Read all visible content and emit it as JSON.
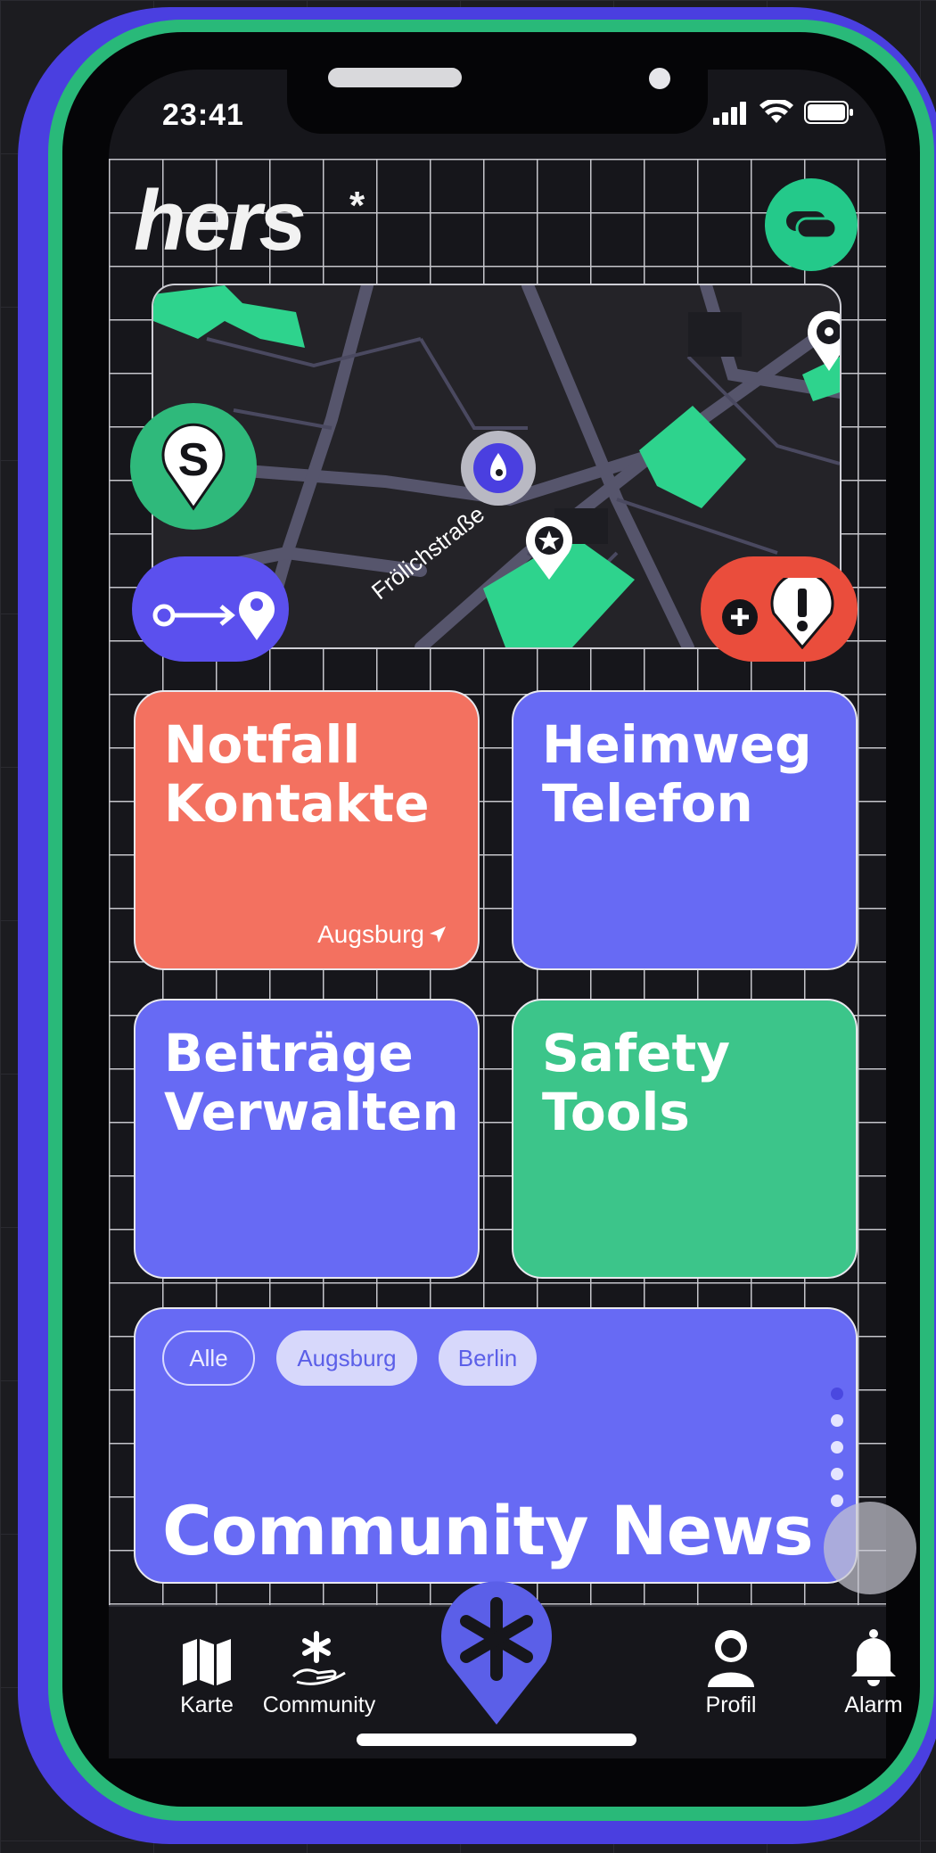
{
  "status_bar": {
    "time": "23:41"
  },
  "app": {
    "logo_text": "hers",
    "logo_mark": "*"
  },
  "map": {
    "street_name": "Frölichstraße",
    "buttons": {
      "safe_spot": "S"
    }
  },
  "tiles": {
    "notfall": {
      "title": "Notfall\nKontakte",
      "city": "Augsburg"
    },
    "heimweg": {
      "title": "Heimweg\nTelefon"
    },
    "beitraege": {
      "title": "Beiträge\nVerwalten"
    },
    "safety": {
      "title": "Safety\nTools"
    }
  },
  "news": {
    "filters": [
      "Alle",
      "Augsburg",
      "Berlin"
    ],
    "title": "Community News",
    "pagination": {
      "total": 5,
      "active": 0
    }
  },
  "tabbar": {
    "items": [
      {
        "label": "Karte",
        "icon": "map-icon"
      },
      {
        "label": "Community",
        "icon": "community-icon"
      },
      {
        "label": "",
        "icon": "asterisk-center-icon"
      },
      {
        "label": "Profil",
        "icon": "profile-icon"
      },
      {
        "label": "Alarm",
        "icon": "bell-icon"
      }
    ]
  },
  "colors": {
    "frame_blue": "#4a3fe0",
    "frame_green": "#29b979",
    "tile_red": "#f37160",
    "tile_violet": "#676af4",
    "tile_green": "#3cc58a",
    "accent_green": "#24c98a"
  }
}
